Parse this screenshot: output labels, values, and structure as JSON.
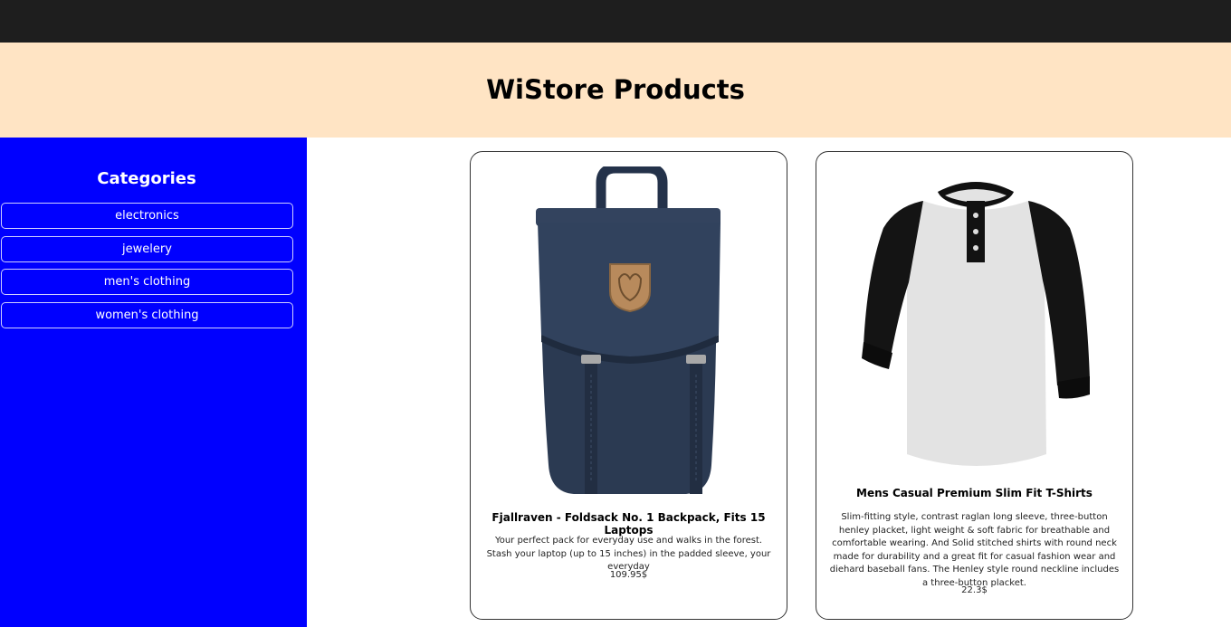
{
  "header": {
    "title": "WiStore Products"
  },
  "sidebar": {
    "heading": "Categories",
    "categories": [
      "electronics",
      "jewelery",
      "men's clothing",
      "women's clothing"
    ]
  },
  "products": [
    {
      "title": "Fjallraven - Foldsack No. 1 Backpack, Fits 15 Laptops",
      "description": "Your perfect pack for everyday use and walks in the forest. Stash your laptop (up to 15 inches) in the padded sleeve, your everyday",
      "price": "109.95$",
      "image": "backpack-image"
    },
    {
      "title": "Mens Casual Premium Slim Fit T-Shirts",
      "description": "Slim-fitting style, contrast raglan long sleeve, three-button henley placket, light weight & soft fabric for breathable and comfortable wearing. And Solid stitched shirts with round neck made for durability and a great fit for casual fashion wear and diehard baseball fans. The Henley style round neckline includes a three-button placket.",
      "price": "22.3$",
      "image": "henley-shirt-image"
    }
  ],
  "colors": {
    "topbar": "#1e1e1e",
    "header_bg": "#ffe4c4",
    "sidebar_bg": "#0000ff",
    "backpack": "#2b3a52",
    "shirt_body": "#e3e3e3",
    "shirt_sleeve": "#111111"
  }
}
